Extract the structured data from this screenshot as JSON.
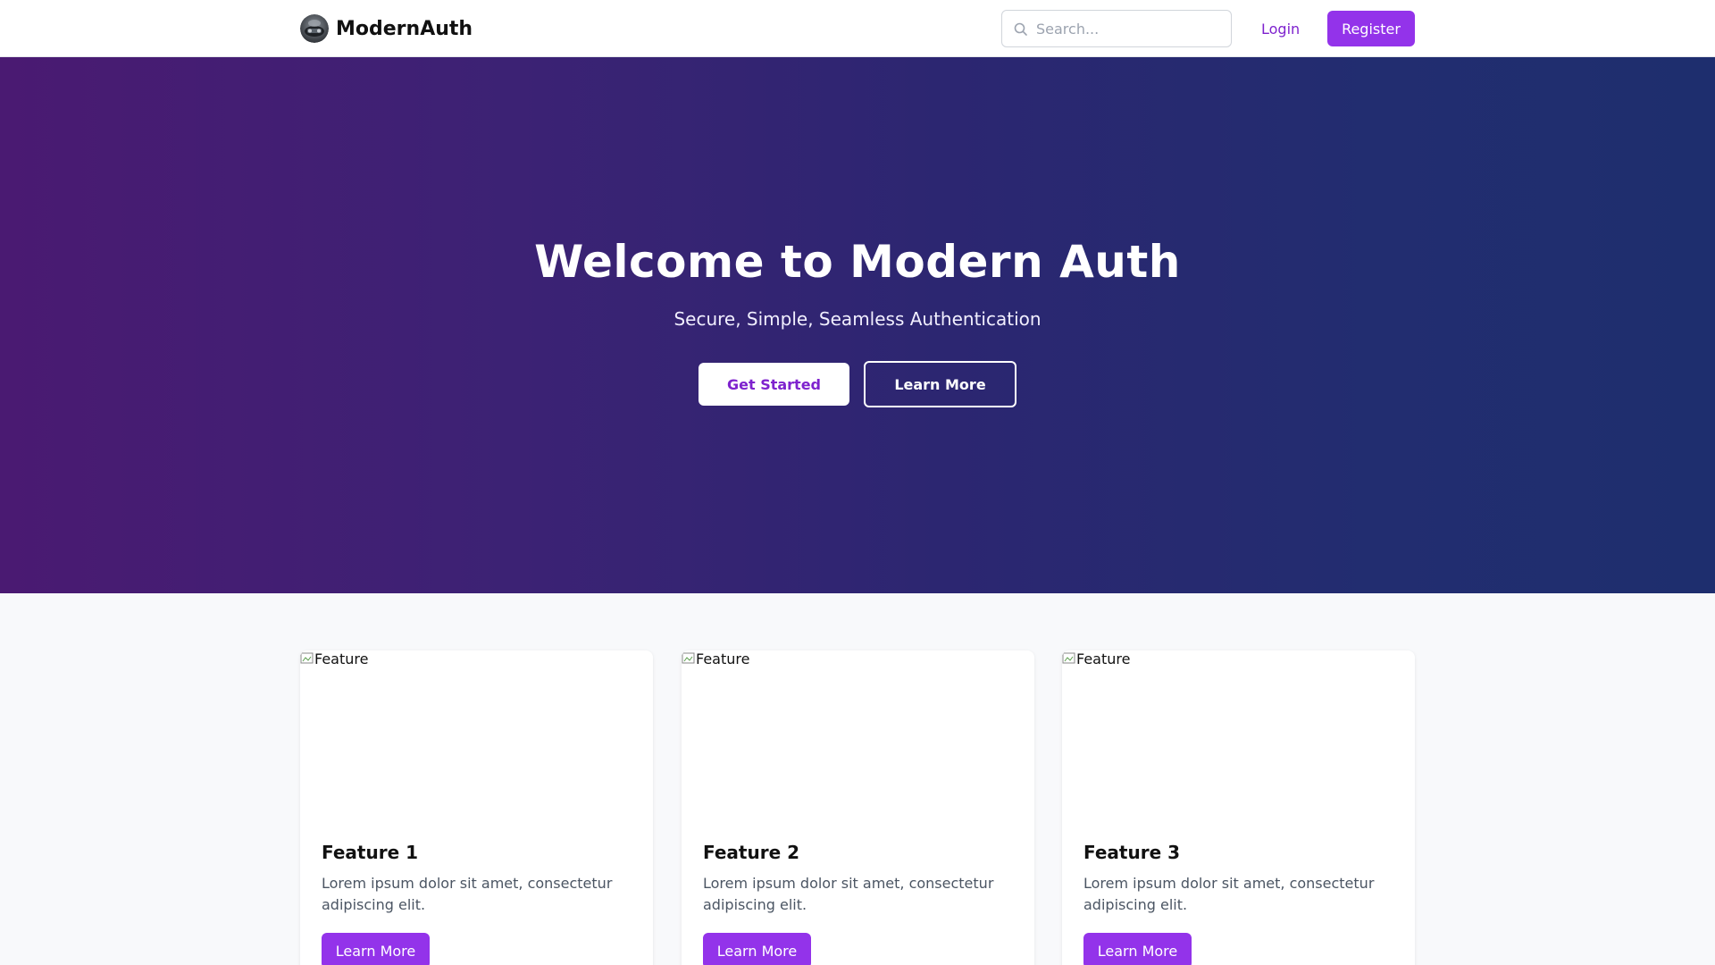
{
  "header": {
    "brand_name": "ModernAuth",
    "search": {
      "placeholder": "Search...",
      "value": ""
    },
    "login_label": "Login",
    "register_label": "Register"
  },
  "hero": {
    "title": "Welcome to Modern Auth",
    "subtitle": "Secure, Simple, Seamless Authentication",
    "primary_button": "Get Started",
    "secondary_button": "Learn More"
  },
  "features": [
    {
      "image_alt": "Feature",
      "title": "Feature 1",
      "text": "Lorem ipsum dolor sit amet, consectetur adipiscing elit.",
      "button": "Learn More"
    },
    {
      "image_alt": "Feature",
      "title": "Feature 2",
      "text": "Lorem ipsum dolor sit amet, consectetur adipiscing elit.",
      "button": "Learn More"
    },
    {
      "image_alt": "Feature",
      "title": "Feature 3",
      "text": "Lorem ipsum dolor sit amet, consectetur adipiscing elit.",
      "button": "Learn More"
    }
  ],
  "icons": {
    "logo": "avatar-logo-icon",
    "search": "search-icon",
    "broken_image": "broken-image-icon"
  },
  "colors": {
    "accent": "#9333ea",
    "accent_text": "#7e22ce",
    "hero_gradient_start": "#4a1a72",
    "hero_gradient_end": "#1e2e6e"
  }
}
